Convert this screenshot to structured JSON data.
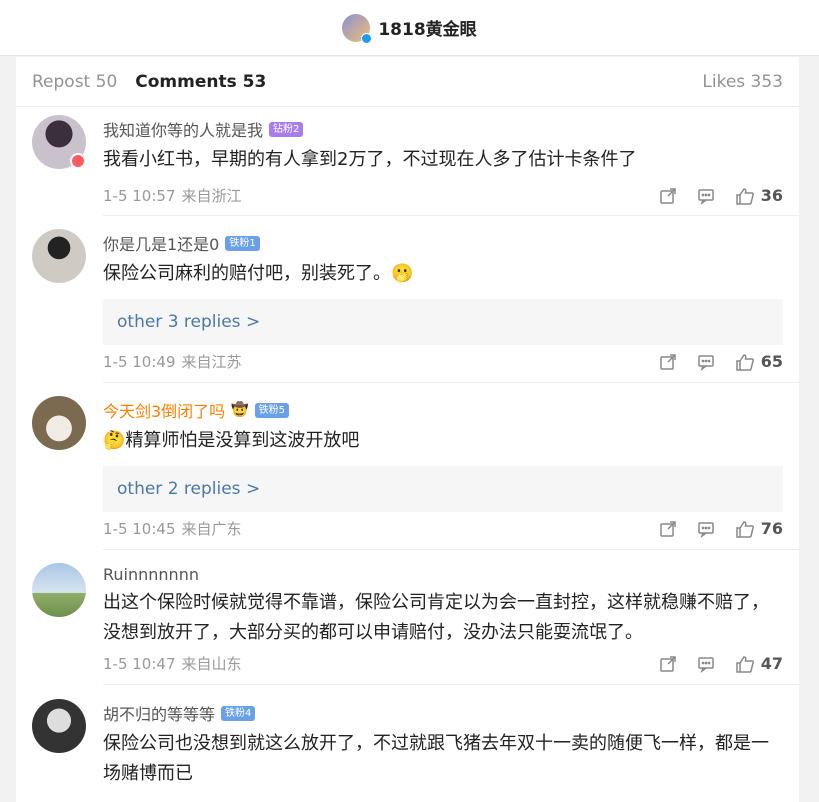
{
  "header": {
    "account_name": "1818黄金眼"
  },
  "tabs": {
    "repost": "Repost 50",
    "comments": "Comments 53",
    "likes": "Likes 353"
  },
  "comments": [
    {
      "username": "我知道你等的人就是我",
      "badge": "钻粉2",
      "text": "我看小红书，早期的有人拿到2万了，不过现在人多了估计卡条件了",
      "time": "1-5 10:57",
      "location": "来自浙江",
      "likes": "36"
    },
    {
      "username": "你是几是1还是0",
      "badge": "铁粉1",
      "text": "保险公司麻利的赔付吧，别装死了。🫢",
      "replies": "other 3 replies >",
      "time": "1-5 10:49",
      "location": "来自江苏",
      "likes": "65"
    },
    {
      "username": "今天剑3倒闭了吗",
      "emoji": "🤠",
      "badge": "铁粉5",
      "text": "🤔精算师怕是没算到这波开放吧",
      "replies": "other 2 replies >",
      "time": "1-5 10:45",
      "location": "来自广东",
      "likes": "76"
    },
    {
      "username": "Ruinnnnnnn",
      "text": "出这个保险时候就觉得不靠谱，保险公司肯定以为会一直封控，这样就稳赚不赔了，没想到放开了，大部分买的都可以申请赔付，没办法只能耍流氓了。",
      "time": "1-5 10:47",
      "location": "来自山东",
      "likes": "47"
    },
    {
      "username": "胡不归的等等等",
      "badge": "铁粉4",
      "text": "保险公司也没想到就这么放开了，不过就跟飞猪去年双十一卖的随便飞一样，都是一场赌博而已"
    }
  ]
}
